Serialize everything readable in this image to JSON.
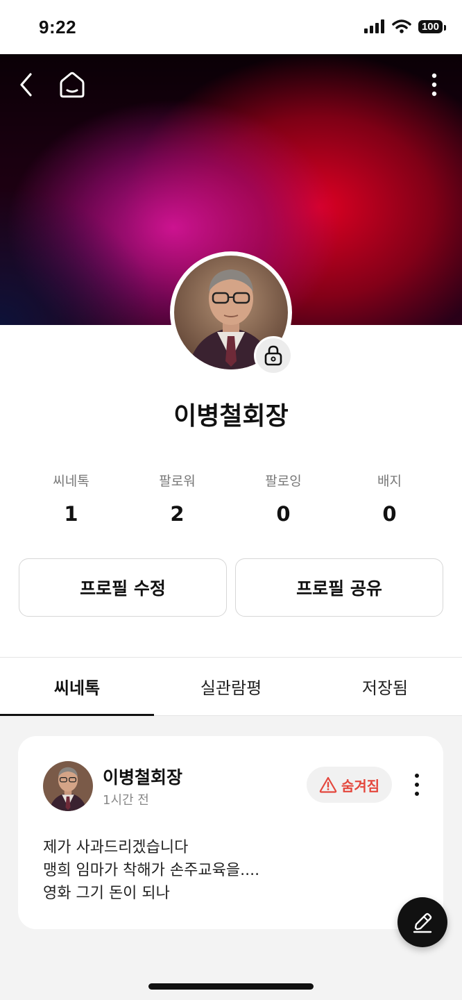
{
  "status_bar": {
    "time": "9:22",
    "battery": "100"
  },
  "profile": {
    "name": "이병철회장",
    "stats": [
      {
        "label": "씨네톡",
        "value": "1"
      },
      {
        "label": "팔로워",
        "value": "2"
      },
      {
        "label": "팔로잉",
        "value": "0"
      },
      {
        "label": "배지",
        "value": "0"
      }
    ],
    "edit_button": "프로필 수정",
    "share_button": "프로필 공유"
  },
  "tabs": [
    {
      "label": "씨네톡",
      "active": true
    },
    {
      "label": "실관람평",
      "active": false
    },
    {
      "label": "저장됨",
      "active": false
    }
  ],
  "post": {
    "author": "이병철회장",
    "time": "1시간 전",
    "status_badge": "숨겨짐",
    "lines": [
      "제가 사과드리겠습니다",
      "맹희 임마가 착해가 손주교육을....",
      "영화 그기 돈이 되나"
    ]
  },
  "colors": {
    "badge_red": "#e4473d",
    "cover_magenta": "#d21496",
    "cover_red": "#dc0023"
  },
  "icons": [
    "signal-icon",
    "wifi-icon",
    "back-icon",
    "home-icon",
    "more-icon",
    "lock-icon",
    "warning-icon",
    "pencil-icon"
  ]
}
